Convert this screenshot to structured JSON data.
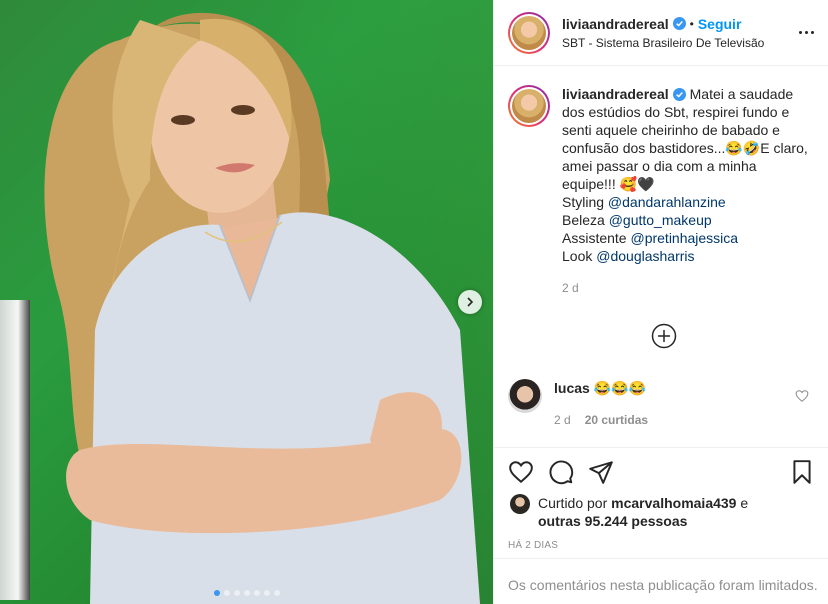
{
  "post": {
    "username": "liviaandradereal",
    "follow_separator": "•",
    "follow_label": "Seguir",
    "location": "SBT - Sistema Brasileiro De Televisão",
    "carousel": {
      "dot_count": 7,
      "active_index": 0
    }
  },
  "caption": {
    "username": "liviaandradereal",
    "text": "Matei a saudade dos estúdios do Sbt, respirei fundo e senti aquele cheirinho de babado e confusão dos bastidores...😂🤣E claro, amei passar o dia com a minha equipe!!! 🥰🖤",
    "credits": [
      {
        "label": "Styling",
        "mention": "@dandarahlanzine"
      },
      {
        "label": "Beleza",
        "mention": "@gutto_makeup"
      },
      {
        "label": "Assistente",
        "mention": "@pretinhajessica"
      },
      {
        "label": "Look",
        "mention": "@douglasharris"
      }
    ],
    "time": "2 d"
  },
  "comment": {
    "username": "lucas",
    "text": "😂😂😂",
    "time": "2 d",
    "likes": "20 curtidas"
  },
  "likes": {
    "prefix": "Curtido por",
    "user": "mcarvalhomaia439",
    "mid": "e",
    "others": "outras 95.244 pessoas"
  },
  "timestamp": "HÁ 2 DIAS",
  "comments_limited": "Os comentários nesta publicação foram limitados.",
  "colors": {
    "accent": "#0095f6",
    "mention": "#00376b",
    "muted": "#8e8e8e",
    "backdrop": "#2a9c3f"
  },
  "icons": [
    "verified-icon",
    "more-icon",
    "add-circle-icon",
    "heart-icon",
    "comment-icon",
    "share-icon",
    "bookmark-icon",
    "chevron-right-icon"
  ]
}
